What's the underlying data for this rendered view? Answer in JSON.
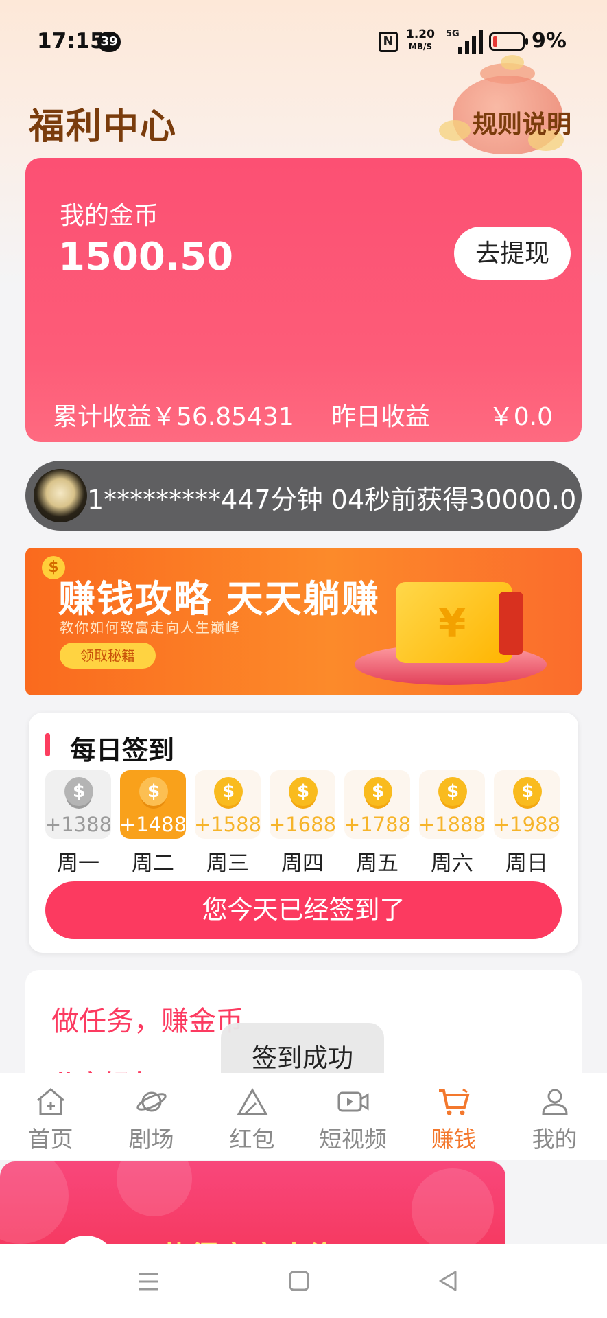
{
  "status_bar": {
    "time": "17:15",
    "notification_count": "39",
    "nfc": "N",
    "net_speed": "1.20",
    "net_unit": "MB/S",
    "network": "5G",
    "battery": "9%"
  },
  "header": {
    "title": "福利中心",
    "rules_link": "规则说明"
  },
  "coin_card": {
    "label": "我的金币",
    "amount": "1500.50",
    "withdraw_button": "去提现",
    "total_income": "累计收益￥56.85431",
    "yesterday_label": "昨日收益",
    "yesterday_value": "￥0.0"
  },
  "ticker": {
    "text": "1*********447分钟 04秒前获得30000.0"
  },
  "banner": {
    "headline": "赚钱攻略 天天躺赚",
    "subline": "教你如何致富走向人生巅峰",
    "button": "领取秘籍"
  },
  "daily_signin": {
    "title": "每日签到",
    "days": [
      {
        "name": "周一",
        "reward": "+1388",
        "state": "past"
      },
      {
        "name": "周二",
        "reward": "+1488",
        "state": "today"
      },
      {
        "name": "周三",
        "reward": "+1588",
        "state": "future"
      },
      {
        "name": "周四",
        "reward": "+1688",
        "state": "future"
      },
      {
        "name": "周五",
        "reward": "+1788",
        "state": "future"
      },
      {
        "name": "周六",
        "reward": "+1888",
        "state": "future"
      },
      {
        "name": "周日",
        "reward": "+1988",
        "state": "future"
      }
    ],
    "done_button": "您今天已经签到了"
  },
  "tasks": {
    "title": "做任务，赚金币",
    "first_task_partial": "分享好友"
  },
  "toast": "签到成功",
  "tab_bar": [
    {
      "label": "首页",
      "icon": "home-icon",
      "active": false
    },
    {
      "label": "剧场",
      "icon": "planet-icon",
      "active": false
    },
    {
      "label": "红包",
      "icon": "triangle-icon",
      "active": false
    },
    {
      "label": "短视频",
      "icon": "video-icon",
      "active": false
    },
    {
      "label": "赚钱",
      "icon": "cart-icon",
      "active": true
    },
    {
      "label": "我的",
      "icon": "user-icon",
      "active": false
    }
  ],
  "popup": {
    "partial_text": "恭得宝宝上海"
  },
  "colors": {
    "accent": "#fc3a60",
    "active_tab": "#f3782d",
    "title_brown": "#7a3c0c"
  }
}
